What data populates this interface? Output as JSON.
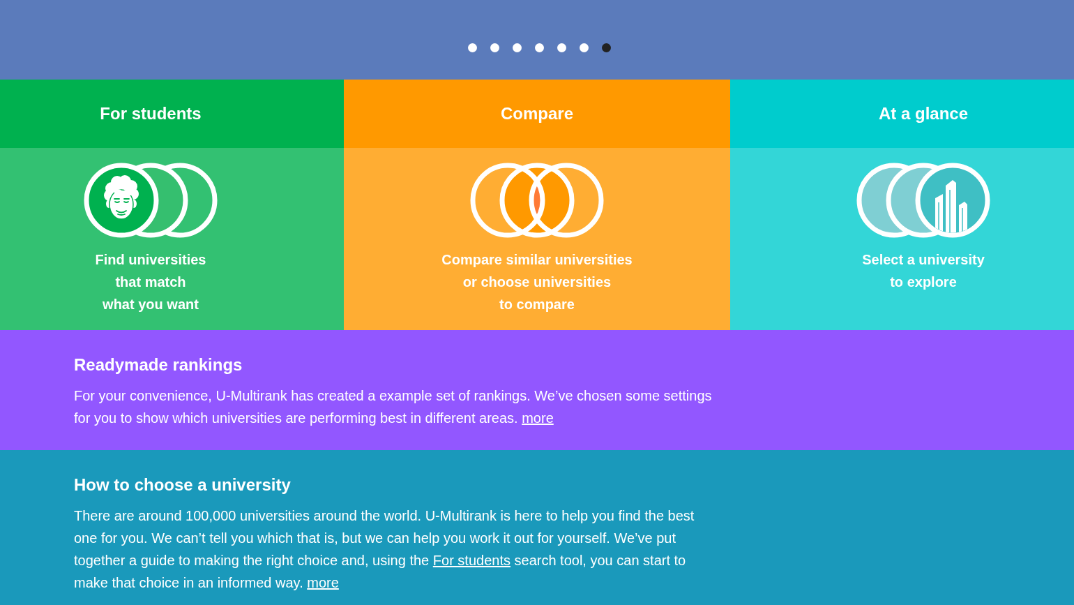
{
  "carousel": {
    "slides": [
      {
        "selected": false
      },
      {
        "selected": false
      },
      {
        "selected": false
      },
      {
        "selected": false
      },
      {
        "selected": false
      },
      {
        "selected": false
      },
      {
        "selected": true
      }
    ]
  },
  "tiles": [
    {
      "kind": "students",
      "title": "For students",
      "color": "#00b14f",
      "description": "Find universities\nthat match\nwhat you want"
    },
    {
      "kind": "compare",
      "title": "Compare",
      "color": "#ff9900",
      "description": "Compare similar universities\nor choose universities\nto compare"
    },
    {
      "kind": "glance",
      "title": "At a glance",
      "color": "#00cccd",
      "description": "Select a university\nto explore"
    }
  ],
  "sections": [
    {
      "heading": "Readymade rankings",
      "color": "#9257ff",
      "body": [
        {
          "kind": "text",
          "text": "For your convenience, U-Multirank has created a example set of rankings. We’ve chosen some settings for you to show which universities are performing best in different areas."
        },
        {
          "kind": "link",
          "text": "more"
        }
      ]
    },
    {
      "heading": "How to choose a university",
      "color": "#1a99bb",
      "body": [
        {
          "kind": "text",
          "text": "There are around 100,000 universities around the world. U-Multirank is here to help you find the best one for you. We can’t tell you which that is, but we can help you work it out for yourself. We’ve put together a guide to making the right choice and, using the"
        },
        {
          "kind": "link",
          "text": "For students"
        },
        {
          "kind": "text",
          "text": "search tool, you can start to make that choice in an informed way."
        },
        {
          "kind": "link",
          "text": "more"
        }
      ]
    }
  ]
}
